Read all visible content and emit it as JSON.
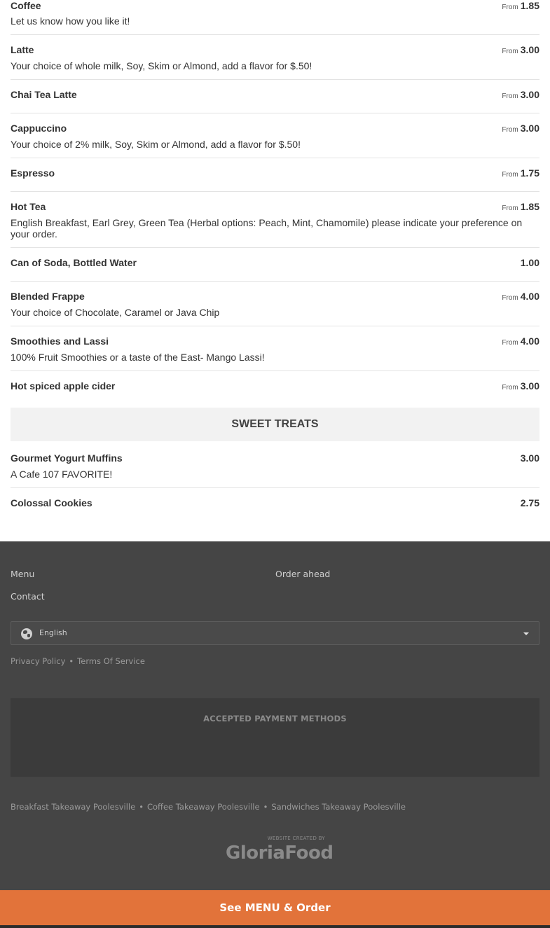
{
  "menu": {
    "items": [
      {
        "name": "Coffee",
        "price_prefix": "From",
        "price": "1.85",
        "description": "Let us know how you like it!"
      },
      {
        "name": "Latte",
        "price_prefix": "From",
        "price": "3.00",
        "description": "Your choice of whole milk, Soy, Skim or Almond, add a flavor for $.50!"
      },
      {
        "name": "Chai Tea Latte",
        "price_prefix": "From",
        "price": "3.00",
        "description": ""
      },
      {
        "name": "Cappuccino",
        "price_prefix": "From",
        "price": "3.00",
        "description": "Your choice of 2% milk, Soy, Skim or Almond, add a flavor for $.50!"
      },
      {
        "name": "Espresso",
        "price_prefix": "From",
        "price": "1.75",
        "description": ""
      },
      {
        "name": "Hot Tea",
        "price_prefix": "From",
        "price": "1.85",
        "description": "English Breakfast, Earl Grey, Green Tea (Herbal options: Peach, Mint, Chamomile) please indicate your preference on your order."
      },
      {
        "name": "Can of Soda, Bottled Water",
        "price_prefix": "",
        "price": "1.00",
        "description": ""
      },
      {
        "name": "Blended Frappe",
        "price_prefix": "From",
        "price": "4.00",
        "description": "Your choice of Chocolate, Caramel or Java Chip"
      },
      {
        "name": "Smoothies and Lassi",
        "price_prefix": "From",
        "price": "4.00",
        "description": "100% Fruit Smoothies or a taste of the East- Mango Lassi!"
      },
      {
        "name": "Hot spiced apple cider",
        "price_prefix": "From",
        "price": "3.00",
        "description": ""
      }
    ],
    "section_title": "SWEET TREATS",
    "sweet_items": [
      {
        "name": "Gourmet Yogurt Muffins",
        "price_prefix": "",
        "price": "3.00",
        "description": "A Cafe 107 FAVORITE!"
      },
      {
        "name": "Colossal Cookies",
        "price_prefix": "",
        "price": "2.75",
        "description": ""
      }
    ]
  },
  "footer": {
    "links": {
      "menu": "Menu",
      "order_ahead": "Order ahead",
      "contact": "Contact"
    },
    "language": {
      "selected": "English",
      "icon": "globe-icon"
    },
    "legal": {
      "privacy": "Privacy Policy",
      "terms": "Terms Of Service",
      "separator": "•"
    },
    "payment_title": "ACCEPTED PAYMENT METHODS",
    "seo_links": [
      "Breakfast Takeaway Poolesville",
      "Coffee Takeaway Poolesville",
      "Sandwiches Takeaway Poolesville"
    ],
    "brand": {
      "created_by": "WEBSITE CREATED BY",
      "name": "GloriaFood"
    }
  },
  "cta": {
    "label": "See MENU & Order",
    "color": "#e2733a"
  }
}
